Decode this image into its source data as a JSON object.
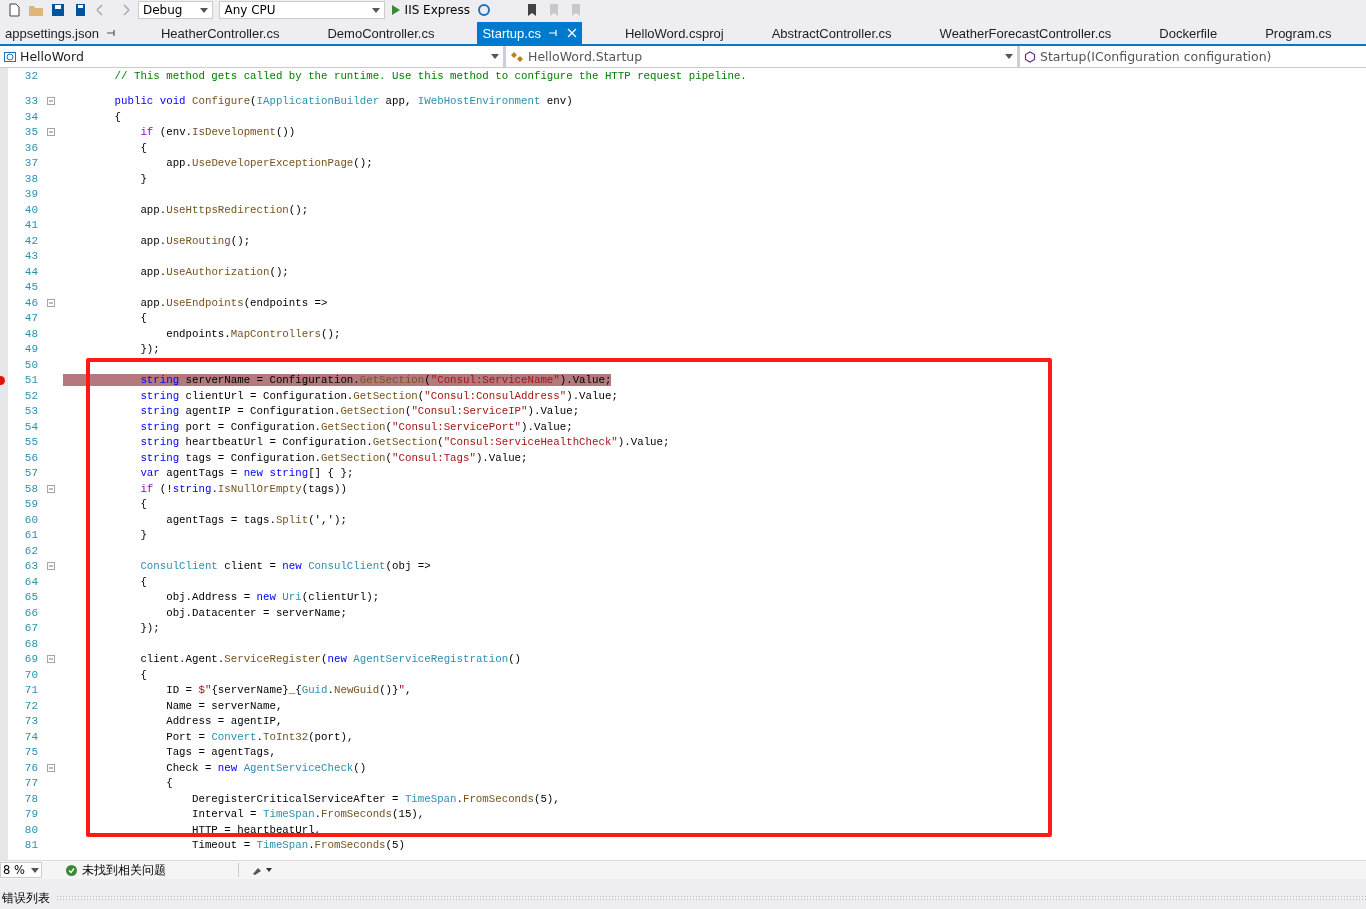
{
  "toolbar": {
    "configuration": "Debug",
    "platform": "Any CPU",
    "run_target": "IIS Express"
  },
  "tabs": [
    {
      "label": "appsettings.json",
      "selected": false,
      "pinned": true
    },
    {
      "label": "HeatherController.cs",
      "selected": false,
      "pinned": false
    },
    {
      "label": "DemoController.cs",
      "selected": false,
      "pinned": false
    },
    {
      "label": "Startup.cs",
      "selected": true,
      "pinned": true
    },
    {
      "label": "HelloWord.csproj",
      "selected": false,
      "pinned": false
    },
    {
      "label": "AbstractController.cs",
      "selected": false,
      "pinned": false
    },
    {
      "label": "WeatherForecastController.cs",
      "selected": false,
      "pinned": false
    },
    {
      "label": "Dockerfile",
      "selected": false,
      "pinned": false
    },
    {
      "label": "Program.cs",
      "selected": false,
      "pinned": false
    }
  ],
  "navigation": {
    "project": "HelloWord",
    "type": "HelloWord.Startup",
    "member": "Startup(IConfiguration configuration)"
  },
  "annotation": {
    "kind": "rectangle"
  },
  "code_lines": [
    {
      "number": "32",
      "fold": false,
      "selected": false,
      "breakpoint": false,
      "tokens": [
        {
          "kind": "comment",
          "text": "        // This method gets called by the runtime. Use this method to configure the HTTP request pipeline."
        }
      ]
    },
    {
      "number": "33",
      "fold": true,
      "selected": false,
      "breakpoint": false,
      "tokens": [
        {
          "kind": "keyword",
          "text": "        public void "
        },
        {
          "kind": "method",
          "text": "Configure"
        },
        {
          "kind": "plain",
          "text": "("
        },
        {
          "kind": "type",
          "text": "IApplicationBuilder"
        },
        {
          "kind": "plain",
          "text": " app, "
        },
        {
          "kind": "type",
          "text": "IWebHostEnvironment"
        },
        {
          "kind": "plain",
          "text": " env)"
        }
      ]
    },
    {
      "number": "34",
      "fold": false,
      "selected": false,
      "breakpoint": false,
      "tokens": [
        {
          "kind": "plain",
          "text": "        {"
        }
      ]
    },
    {
      "number": "35",
      "fold": true,
      "selected": false,
      "breakpoint": false,
      "tokens": [
        {
          "kind": "control",
          "text": "            if"
        },
        {
          "kind": "plain",
          "text": " (env."
        },
        {
          "kind": "method",
          "text": "IsDevelopment"
        },
        {
          "kind": "plain",
          "text": "())"
        }
      ]
    },
    {
      "number": "36",
      "fold": false,
      "selected": false,
      "breakpoint": false,
      "tokens": [
        {
          "kind": "plain",
          "text": "            {"
        }
      ]
    },
    {
      "number": "37",
      "fold": false,
      "selected": false,
      "breakpoint": false,
      "tokens": [
        {
          "kind": "plain",
          "text": "                app."
        },
        {
          "kind": "method",
          "text": "UseDeveloperExceptionPage"
        },
        {
          "kind": "plain",
          "text": "();"
        }
      ]
    },
    {
      "number": "38",
      "fold": false,
      "selected": false,
      "breakpoint": false,
      "tokens": [
        {
          "kind": "plain",
          "text": "            }"
        }
      ]
    },
    {
      "number": "39",
      "fold": false,
      "selected": false,
      "breakpoint": false
    },
    {
      "number": "40",
      "fold": false,
      "selected": false,
      "breakpoint": false,
      "tokens": [
        {
          "kind": "plain",
          "text": "            app."
        },
        {
          "kind": "method",
          "text": "UseHttpsRedirection"
        },
        {
          "kind": "plain",
          "text": "();"
        }
      ]
    },
    {
      "number": "41",
      "fold": false,
      "selected": false,
      "breakpoint": false
    },
    {
      "number": "42",
      "fold": false,
      "selected": false,
      "breakpoint": false,
      "tokens": [
        {
          "kind": "plain",
          "text": "            app."
        },
        {
          "kind": "method",
          "text": "UseRouting"
        },
        {
          "kind": "plain",
          "text": "();"
        }
      ]
    },
    {
      "number": "43",
      "fold": false,
      "selected": false,
      "breakpoint": false
    },
    {
      "number": "44",
      "fold": false,
      "selected": false,
      "breakpoint": false,
      "tokens": [
        {
          "kind": "plain",
          "text": "            app."
        },
        {
          "kind": "method",
          "text": "UseAuthorization"
        },
        {
          "kind": "plain",
          "text": "();"
        }
      ]
    },
    {
      "number": "45",
      "fold": false,
      "selected": false,
      "breakpoint": false
    },
    {
      "number": "46",
      "fold": true,
      "selected": false,
      "breakpoint": false,
      "tokens": [
        {
          "kind": "plain",
          "text": "            app."
        },
        {
          "kind": "method",
          "text": "UseEndpoints"
        },
        {
          "kind": "plain",
          "text": "(endpoints =>"
        }
      ]
    },
    {
      "number": "47",
      "fold": false,
      "selected": false,
      "breakpoint": false,
      "tokens": [
        {
          "kind": "plain",
          "text": "            {"
        }
      ]
    },
    {
      "number": "48",
      "fold": false,
      "selected": false,
      "breakpoint": false,
      "tokens": [
        {
          "kind": "plain",
          "text": "                endpoints."
        },
        {
          "kind": "method",
          "text": "MapControllers"
        },
        {
          "kind": "plain",
          "text": "();"
        }
      ]
    },
    {
      "number": "49",
      "fold": false,
      "selected": false,
      "breakpoint": false,
      "tokens": [
        {
          "kind": "plain",
          "text": "            });"
        }
      ]
    },
    {
      "number": "50",
      "fold": false,
      "selected": false,
      "breakpoint": false
    },
    {
      "number": "51",
      "fold": false,
      "selected": true,
      "breakpoint": true,
      "tokens": [
        {
          "kind": "keyword",
          "text": "            string"
        },
        {
          "kind": "plain",
          "text": " serverName = Configuration."
        },
        {
          "kind": "method",
          "text": "GetSection"
        },
        {
          "kind": "plain",
          "text": "("
        },
        {
          "kind": "string",
          "text": "\"Consul:ServiceName\""
        },
        {
          "kind": "plain",
          "text": ").Value;"
        }
      ]
    },
    {
      "number": "52",
      "fold": false,
      "selected": false,
      "breakpoint": false,
      "tokens": [
        {
          "kind": "keyword",
          "text": "            string"
        },
        {
          "kind": "plain",
          "text": " clientUrl = Configuration."
        },
        {
          "kind": "method",
          "text": "GetSection"
        },
        {
          "kind": "plain",
          "text": "("
        },
        {
          "kind": "string",
          "text": "\"Consul:ConsulAddress\""
        },
        {
          "kind": "plain",
          "text": ").Value;"
        }
      ]
    },
    {
      "number": "53",
      "fold": false,
      "selected": false,
      "breakpoint": false,
      "tokens": [
        {
          "kind": "keyword",
          "text": "            string"
        },
        {
          "kind": "plain",
          "text": " agentIP = Configuration."
        },
        {
          "kind": "method",
          "text": "GetSection"
        },
        {
          "kind": "plain",
          "text": "("
        },
        {
          "kind": "string",
          "text": "\"Consul:ServiceIP\""
        },
        {
          "kind": "plain",
          "text": ").Value;"
        }
      ]
    },
    {
      "number": "54",
      "fold": false,
      "selected": false,
      "breakpoint": false,
      "tokens": [
        {
          "kind": "keyword",
          "text": "            string"
        },
        {
          "kind": "plain",
          "text": " port = Configuration."
        },
        {
          "kind": "method",
          "text": "GetSection"
        },
        {
          "kind": "plain",
          "text": "("
        },
        {
          "kind": "string",
          "text": "\"Consul:ServicePort\""
        },
        {
          "kind": "plain",
          "text": ").Value;"
        }
      ]
    },
    {
      "number": "55",
      "fold": false,
      "selected": false,
      "breakpoint": false,
      "tokens": [
        {
          "kind": "keyword",
          "text": "            string"
        },
        {
          "kind": "plain",
          "text": " heartbeatUrl = Configuration."
        },
        {
          "kind": "method",
          "text": "GetSection"
        },
        {
          "kind": "plain",
          "text": "("
        },
        {
          "kind": "string",
          "text": "\"Consul:ServiceHealthCheck\""
        },
        {
          "kind": "plain",
          "text": ").Value;"
        }
      ]
    },
    {
      "number": "56",
      "fold": false,
      "selected": false,
      "breakpoint": false,
      "tokens": [
        {
          "kind": "keyword",
          "text": "            string"
        },
        {
          "kind": "plain",
          "text": " tags = Configuration."
        },
        {
          "kind": "method",
          "text": "GetSection"
        },
        {
          "kind": "plain",
          "text": "("
        },
        {
          "kind": "string",
          "text": "\"Consul:Tags\""
        },
        {
          "kind": "plain",
          "text": ").Value;"
        }
      ]
    },
    {
      "number": "57",
      "fold": false,
      "selected": false,
      "breakpoint": false,
      "tokens": [
        {
          "kind": "keyword",
          "text": "            var"
        },
        {
          "kind": "plain",
          "text": " agentTags = "
        },
        {
          "kind": "keyword",
          "text": "new string"
        },
        {
          "kind": "plain",
          "text": "[] { };"
        }
      ]
    },
    {
      "number": "58",
      "fold": true,
      "selected": false,
      "breakpoint": false,
      "tokens": [
        {
          "kind": "control",
          "text": "            if"
        },
        {
          "kind": "plain",
          "text": " (!"
        },
        {
          "kind": "keyword",
          "text": "string"
        },
        {
          "kind": "plain",
          "text": "."
        },
        {
          "kind": "method",
          "text": "IsNullOrEmpty"
        },
        {
          "kind": "plain",
          "text": "(tags))"
        }
      ]
    },
    {
      "number": "59",
      "fold": false,
      "selected": false,
      "breakpoint": false,
      "tokens": [
        {
          "kind": "plain",
          "text": "            {"
        }
      ]
    },
    {
      "number": "60",
      "fold": false,
      "selected": false,
      "breakpoint": false,
      "tokens": [
        {
          "kind": "plain",
          "text": "                agentTags = tags."
        },
        {
          "kind": "method",
          "text": "Split"
        },
        {
          "kind": "plain",
          "text": "(','"
        },
        {
          "kind": "plain",
          "text": ");"
        }
      ]
    },
    {
      "number": "61",
      "fold": false,
      "selected": false,
      "breakpoint": false,
      "tokens": [
        {
          "kind": "plain",
          "text": "            }"
        }
      ]
    },
    {
      "number": "62",
      "fold": false,
      "selected": false,
      "breakpoint": false
    },
    {
      "number": "63",
      "fold": true,
      "selected": false,
      "breakpoint": false,
      "tokens": [
        {
          "kind": "type",
          "text": "            ConsulClient"
        },
        {
          "kind": "plain",
          "text": " client = "
        },
        {
          "kind": "keyword",
          "text": "new "
        },
        {
          "kind": "type",
          "text": "ConsulClient"
        },
        {
          "kind": "plain",
          "text": "(obj =>"
        }
      ]
    },
    {
      "number": "64",
      "fold": false,
      "selected": false,
      "breakpoint": false,
      "tokens": [
        {
          "kind": "plain",
          "text": "            {"
        }
      ]
    },
    {
      "number": "65",
      "fold": false,
      "selected": false,
      "breakpoint": false,
      "tokens": [
        {
          "kind": "plain",
          "text": "                obj.Address = "
        },
        {
          "kind": "keyword",
          "text": "new "
        },
        {
          "kind": "type",
          "text": "Uri"
        },
        {
          "kind": "plain",
          "text": "(clientUrl);"
        }
      ]
    },
    {
      "number": "66",
      "fold": false,
      "selected": false,
      "breakpoint": false,
      "tokens": [
        {
          "kind": "plain",
          "text": "                obj.Datacenter = serverName;"
        }
      ]
    },
    {
      "number": "67",
      "fold": false,
      "selected": false,
      "breakpoint": false,
      "tokens": [
        {
          "kind": "plain",
          "text": "            });"
        }
      ]
    },
    {
      "number": "68",
      "fold": false,
      "selected": false,
      "breakpoint": false
    },
    {
      "number": "69",
      "fold": true,
      "selected": false,
      "breakpoint": false,
      "tokens": [
        {
          "kind": "plain",
          "text": "            client.Agent."
        },
        {
          "kind": "method",
          "text": "ServiceRegister"
        },
        {
          "kind": "plain",
          "text": "("
        },
        {
          "kind": "keyword",
          "text": "new "
        },
        {
          "kind": "type",
          "text": "AgentServiceRegistration"
        },
        {
          "kind": "plain",
          "text": "()"
        }
      ]
    },
    {
      "number": "70",
      "fold": false,
      "selected": false,
      "breakpoint": false,
      "tokens": [
        {
          "kind": "plain",
          "text": "            {"
        }
      ]
    },
    {
      "number": "71",
      "fold": false,
      "selected": false,
      "breakpoint": false,
      "tokens": [
        {
          "kind": "plain",
          "text": "                ID = "
        },
        {
          "kind": "string",
          "text": "$\""
        },
        {
          "kind": "plain",
          "text": "{serverName}"
        },
        {
          "kind": "string",
          "text": "_"
        },
        {
          "kind": "plain",
          "text": "{"
        },
        {
          "kind": "type",
          "text": "Guid"
        },
        {
          "kind": "plain",
          "text": "."
        },
        {
          "kind": "method",
          "text": "NewGuid"
        },
        {
          "kind": "plain",
          "text": "()}"
        },
        {
          "kind": "string",
          "text": "\""
        },
        {
          "kind": "plain",
          "text": ","
        }
      ]
    },
    {
      "number": "72",
      "fold": false,
      "selected": false,
      "breakpoint": false,
      "tokens": [
        {
          "kind": "plain",
          "text": "                Name = serverName,"
        }
      ]
    },
    {
      "number": "73",
      "fold": false,
      "selected": false,
      "breakpoint": false,
      "tokens": [
        {
          "kind": "plain",
          "text": "                Address = agentIP,"
        }
      ]
    },
    {
      "number": "74",
      "fold": false,
      "selected": false,
      "breakpoint": false,
      "tokens": [
        {
          "kind": "plain",
          "text": "                Port = "
        },
        {
          "kind": "type",
          "text": "Convert"
        },
        {
          "kind": "plain",
          "text": "."
        },
        {
          "kind": "method",
          "text": "ToInt32"
        },
        {
          "kind": "plain",
          "text": "(port),"
        }
      ]
    },
    {
      "number": "75",
      "fold": false,
      "selected": false,
      "breakpoint": false,
      "tokens": [
        {
          "kind": "plain",
          "text": "                Tags = agentTags,"
        }
      ]
    },
    {
      "number": "76",
      "fold": true,
      "selected": false,
      "breakpoint": false,
      "tokens": [
        {
          "kind": "plain",
          "text": "                Check = "
        },
        {
          "kind": "keyword",
          "text": "new "
        },
        {
          "kind": "type",
          "text": "AgentServiceCheck"
        },
        {
          "kind": "plain",
          "text": "()"
        }
      ]
    },
    {
      "number": "77",
      "fold": false,
      "selected": false,
      "breakpoint": false,
      "tokens": [
        {
          "kind": "plain",
          "text": "                {"
        }
      ]
    },
    {
      "number": "78",
      "fold": false,
      "selected": false,
      "breakpoint": false,
      "tokens": [
        {
          "kind": "plain",
          "text": "                    DeregisterCriticalServiceAfter = "
        },
        {
          "kind": "type",
          "text": "TimeSpan"
        },
        {
          "kind": "plain",
          "text": "."
        },
        {
          "kind": "method",
          "text": "FromSeconds"
        },
        {
          "kind": "plain",
          "text": "(5),"
        }
      ]
    },
    {
      "number": "79",
      "fold": false,
      "selected": false,
      "breakpoint": false,
      "tokens": [
        {
          "kind": "plain",
          "text": "                    Interval = "
        },
        {
          "kind": "type",
          "text": "TimeSpan"
        },
        {
          "kind": "plain",
          "text": "."
        },
        {
          "kind": "method",
          "text": "FromSeconds"
        },
        {
          "kind": "plain",
          "text": "(15),"
        }
      ]
    },
    {
      "number": "80",
      "fold": false,
      "selected": false,
      "breakpoint": false,
      "tokens": [
        {
          "kind": "plain",
          "text": "                    HTTP = heartbeatUrl,"
        }
      ]
    },
    {
      "number": "81",
      "fold": false,
      "selected": false,
      "breakpoint": false,
      "tokens": [
        {
          "kind": "plain",
          "text": "                    Timeout = "
        },
        {
          "kind": "type",
          "text": "TimeSpan"
        },
        {
          "kind": "plain",
          "text": "."
        },
        {
          "kind": "method",
          "text": "FromSeconds"
        },
        {
          "kind": "plain",
          "text": "(5)"
        }
      ]
    }
  ],
  "status_bar": {
    "zoom": "8 %",
    "issues": "未找到相关问题"
  },
  "bottom_panel": {
    "tab": "错误列表"
  }
}
